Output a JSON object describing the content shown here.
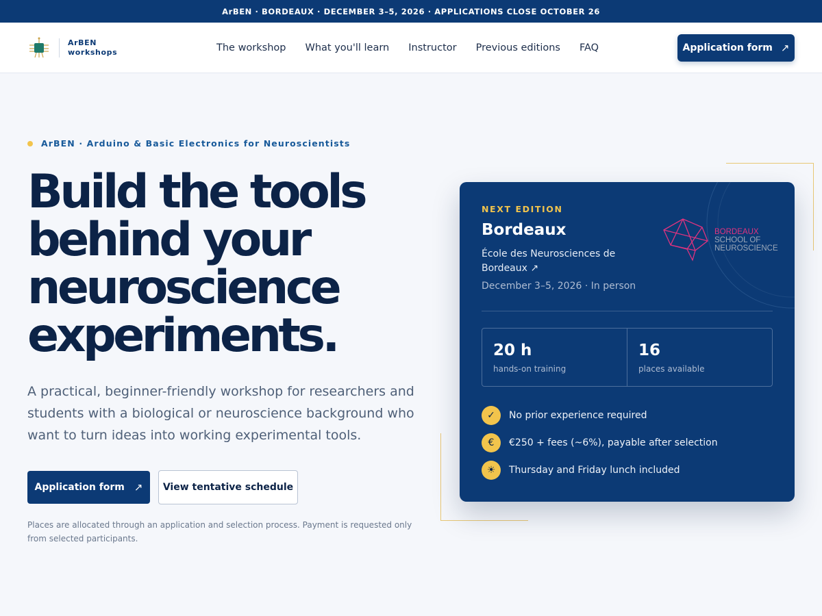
{
  "announcement": "ArBEN · BORDEAUX · DECEMBER 3–5, 2026 · APPLICATIONS CLOSE OCTOBER 26",
  "brand": {
    "line1": "ArBEN",
    "line2": "workshops",
    "logo_icon": "chip-icon"
  },
  "nav": {
    "items": [
      "The workshop",
      "What you'll learn",
      "Instructor",
      "Previous editions",
      "FAQ"
    ],
    "cta_label": "Application form",
    "cta_icon": "↗"
  },
  "hero": {
    "eyebrow": "ArBEN · Arduino & Basic Electronics for Neuroscientists",
    "headline": [
      "Build the tools",
      "behind your",
      "neuroscience",
      "experiments."
    ],
    "lede": "A practical, beginner-friendly workshop for researchers and students with a biological or neuroscience background who want to turn ideas into working experimental tools.",
    "primary_cta": "Application form",
    "primary_cta_icon": "↗",
    "secondary_cta": "View tentative schedule",
    "footnote": "Places are allocated through an application and selection process. Payment is requested only from selected participants."
  },
  "card": {
    "label": "NEXT EDITION",
    "city": "Bordeaux",
    "venue": "École des Neurosciences de Bordeaux ↗",
    "dates": "December 3–5, 2026 · In person",
    "partner_logo": {
      "lines": [
        "BORDEAUX",
        "SCHOOL OF",
        "NEUROSCIENCE"
      ],
      "icon": "brain-icon"
    },
    "stats": [
      {
        "value": "20 h",
        "label": "hands-on training"
      },
      {
        "value": "16",
        "label": "places available"
      }
    ],
    "features": [
      {
        "icon": "✓",
        "text": "No prior experience required"
      },
      {
        "icon": "€",
        "text": "€250 + fees (~6%), payable after selection"
      },
      {
        "icon": "☀",
        "text": "Thursday and Friday lunch included"
      }
    ]
  },
  "colors": {
    "primary": "#0c3a75",
    "accent": "#f2c44c",
    "logo_pink": "#e0337f",
    "background": "#f5f7fb"
  }
}
